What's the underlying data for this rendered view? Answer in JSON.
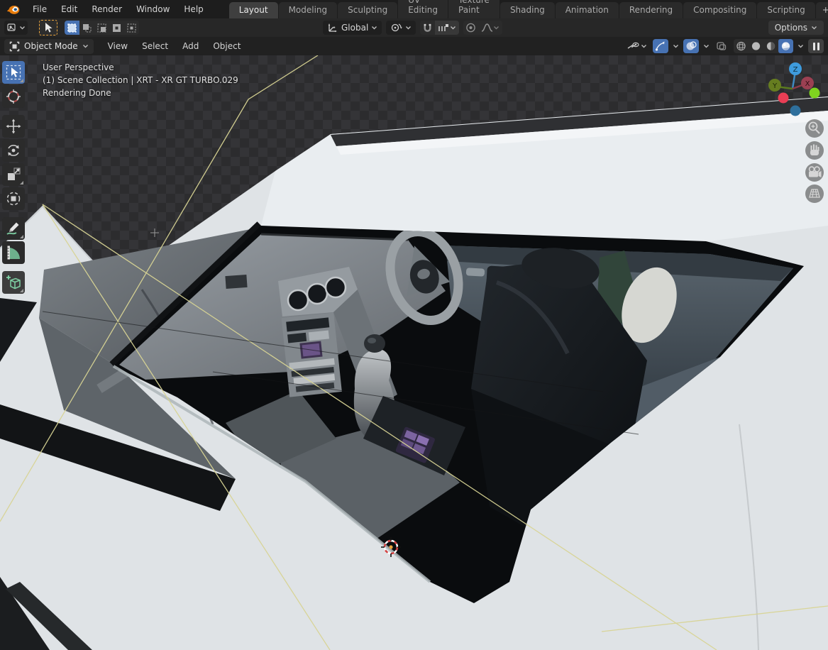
{
  "topbar": {
    "menus": [
      "File",
      "Edit",
      "Render",
      "Window",
      "Help"
    ],
    "tabs": [
      "Layout",
      "Modeling",
      "Sculpting",
      "UV Editing",
      "Texture Paint",
      "Shading",
      "Animation",
      "Rendering",
      "Compositing",
      "Scripting"
    ],
    "active_tab": "Layout",
    "add_tab_label": "+"
  },
  "tool_settings": {
    "orientation_label": "Global",
    "options_label": "Options"
  },
  "viewport_header": {
    "mode_label": "Object Mode",
    "menus": [
      "View",
      "Select",
      "Add",
      "Object"
    ]
  },
  "viewport": {
    "overlay": {
      "line1": "User Perspective",
      "line2": "(1) Scene Collection | XRT - XR GT TURBO.029",
      "line3": "Rendering Done"
    },
    "gizmo": {
      "x": "X",
      "y": "Y",
      "z": "Z"
    }
  },
  "colors": {
    "accent": "#4772b3",
    "checker-dark": "#2c2c2e",
    "checker-light": "#343437",
    "body-white": "#dfe3e6",
    "light-ray": "#d8d494",
    "axis-x": "#ea3e55",
    "axis-y": "#7fd41f",
    "axis-z": "#3e9bdd"
  }
}
